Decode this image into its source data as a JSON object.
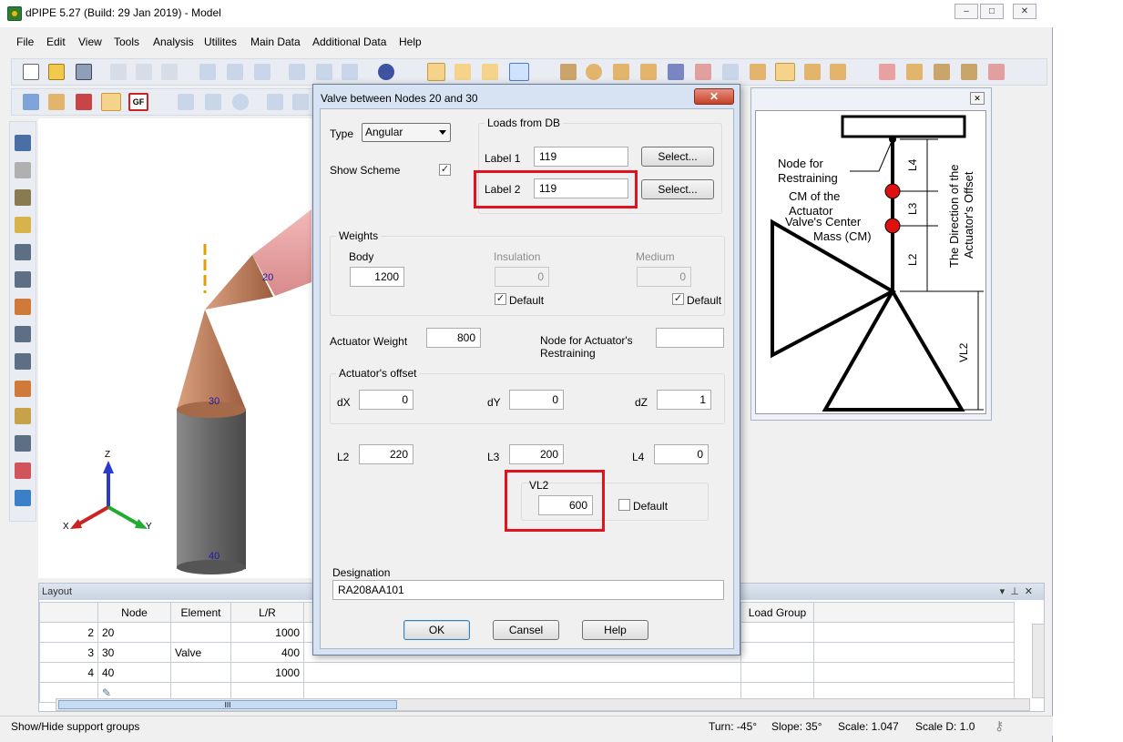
{
  "app": {
    "title": "dPIPE 5.27 (Build: 29 Jan 2019) - Model",
    "window_buttons": [
      "–",
      "□",
      "✕"
    ]
  },
  "menu": [
    "File",
    "Edit",
    "View",
    "Tools",
    "Analysis",
    "Utilites",
    "Main Data",
    "Additional Data",
    "Help"
  ],
  "toolbar2": {
    "gf_label": "GF"
  },
  "viewport": {
    "node_labels": [
      "20",
      "30",
      "40"
    ],
    "axes": {
      "z": "Z",
      "x": "X",
      "y": "Y"
    }
  },
  "dialog": {
    "title": "Valve between Nodes 20 and 30",
    "close": "✕",
    "type_label": "Type",
    "type_value": "Angular",
    "show_scheme_label": "Show Scheme",
    "loads_group": "Loads from DB",
    "label1": "Label 1",
    "label1_value": "119",
    "label2": "Label 2",
    "label2_value": "119",
    "select_button": "Select...",
    "weights_group": "Weights",
    "body_label": "Body",
    "body_value": "1200",
    "insulation_label": "Insulation",
    "insulation_value": "0",
    "medium_label": "Medium",
    "medium_value": "0",
    "default_label": "Default",
    "actuator_weight_label": "Actuator Weight",
    "actuator_weight_value": "800",
    "node_restr_label_1": "Node for Actuator's",
    "node_restr_label_2": "Restraining",
    "node_restr_value": "",
    "offset_group": "Actuator's offset",
    "dx_label": "dX",
    "dx_value": "0",
    "dy_label": "dY",
    "dy_value": "0",
    "dz_label": "dZ",
    "dz_value": "1",
    "l2_label": "L2",
    "l2_value": "220",
    "l3_label": "L3",
    "l3_value": "200",
    "l4_label": "L4",
    "l4_value": "0",
    "vl2_group": "VL2",
    "vl2_value": "600",
    "designation_label": "Designation",
    "designation_value": "RA208AA101",
    "ok": "OK",
    "cancel": "Cansel",
    "help": "Help"
  },
  "scheme": {
    "close": "✕",
    "node_restr_1": "Node for",
    "node_restr_2": "Restraining",
    "cm_actuator_1": "CM of the",
    "cm_actuator_2": "Actuator",
    "valve_center_1": "Valve's Center",
    "valve_center_2": "Mass (CM)",
    "direction_1": "The Direction of the",
    "direction_2": "Actuator's Offset",
    "l4": "L4",
    "l3": "L3",
    "l2": "L2",
    "vl2": "VL2"
  },
  "layout": {
    "title": "Layout",
    "headers": [
      "",
      "Node",
      "Element",
      "L/R",
      "Load Group"
    ],
    "rows": [
      {
        "idx": "2",
        "node": "20",
        "element": "",
        "lr": "1000"
      },
      {
        "idx": "3",
        "node": "30",
        "element": "Valve",
        "lr": "400"
      },
      {
        "idx": "4",
        "node": "40",
        "element": "",
        "lr": "1000"
      }
    ],
    "scroll_grip": "III"
  },
  "status": {
    "hint": "Show/Hide support groups",
    "turn": "Turn: -45°",
    "slope": "Slope: 35°",
    "scale": "Scale: 1.047",
    "scale_d": "Scale D: 1.0"
  }
}
